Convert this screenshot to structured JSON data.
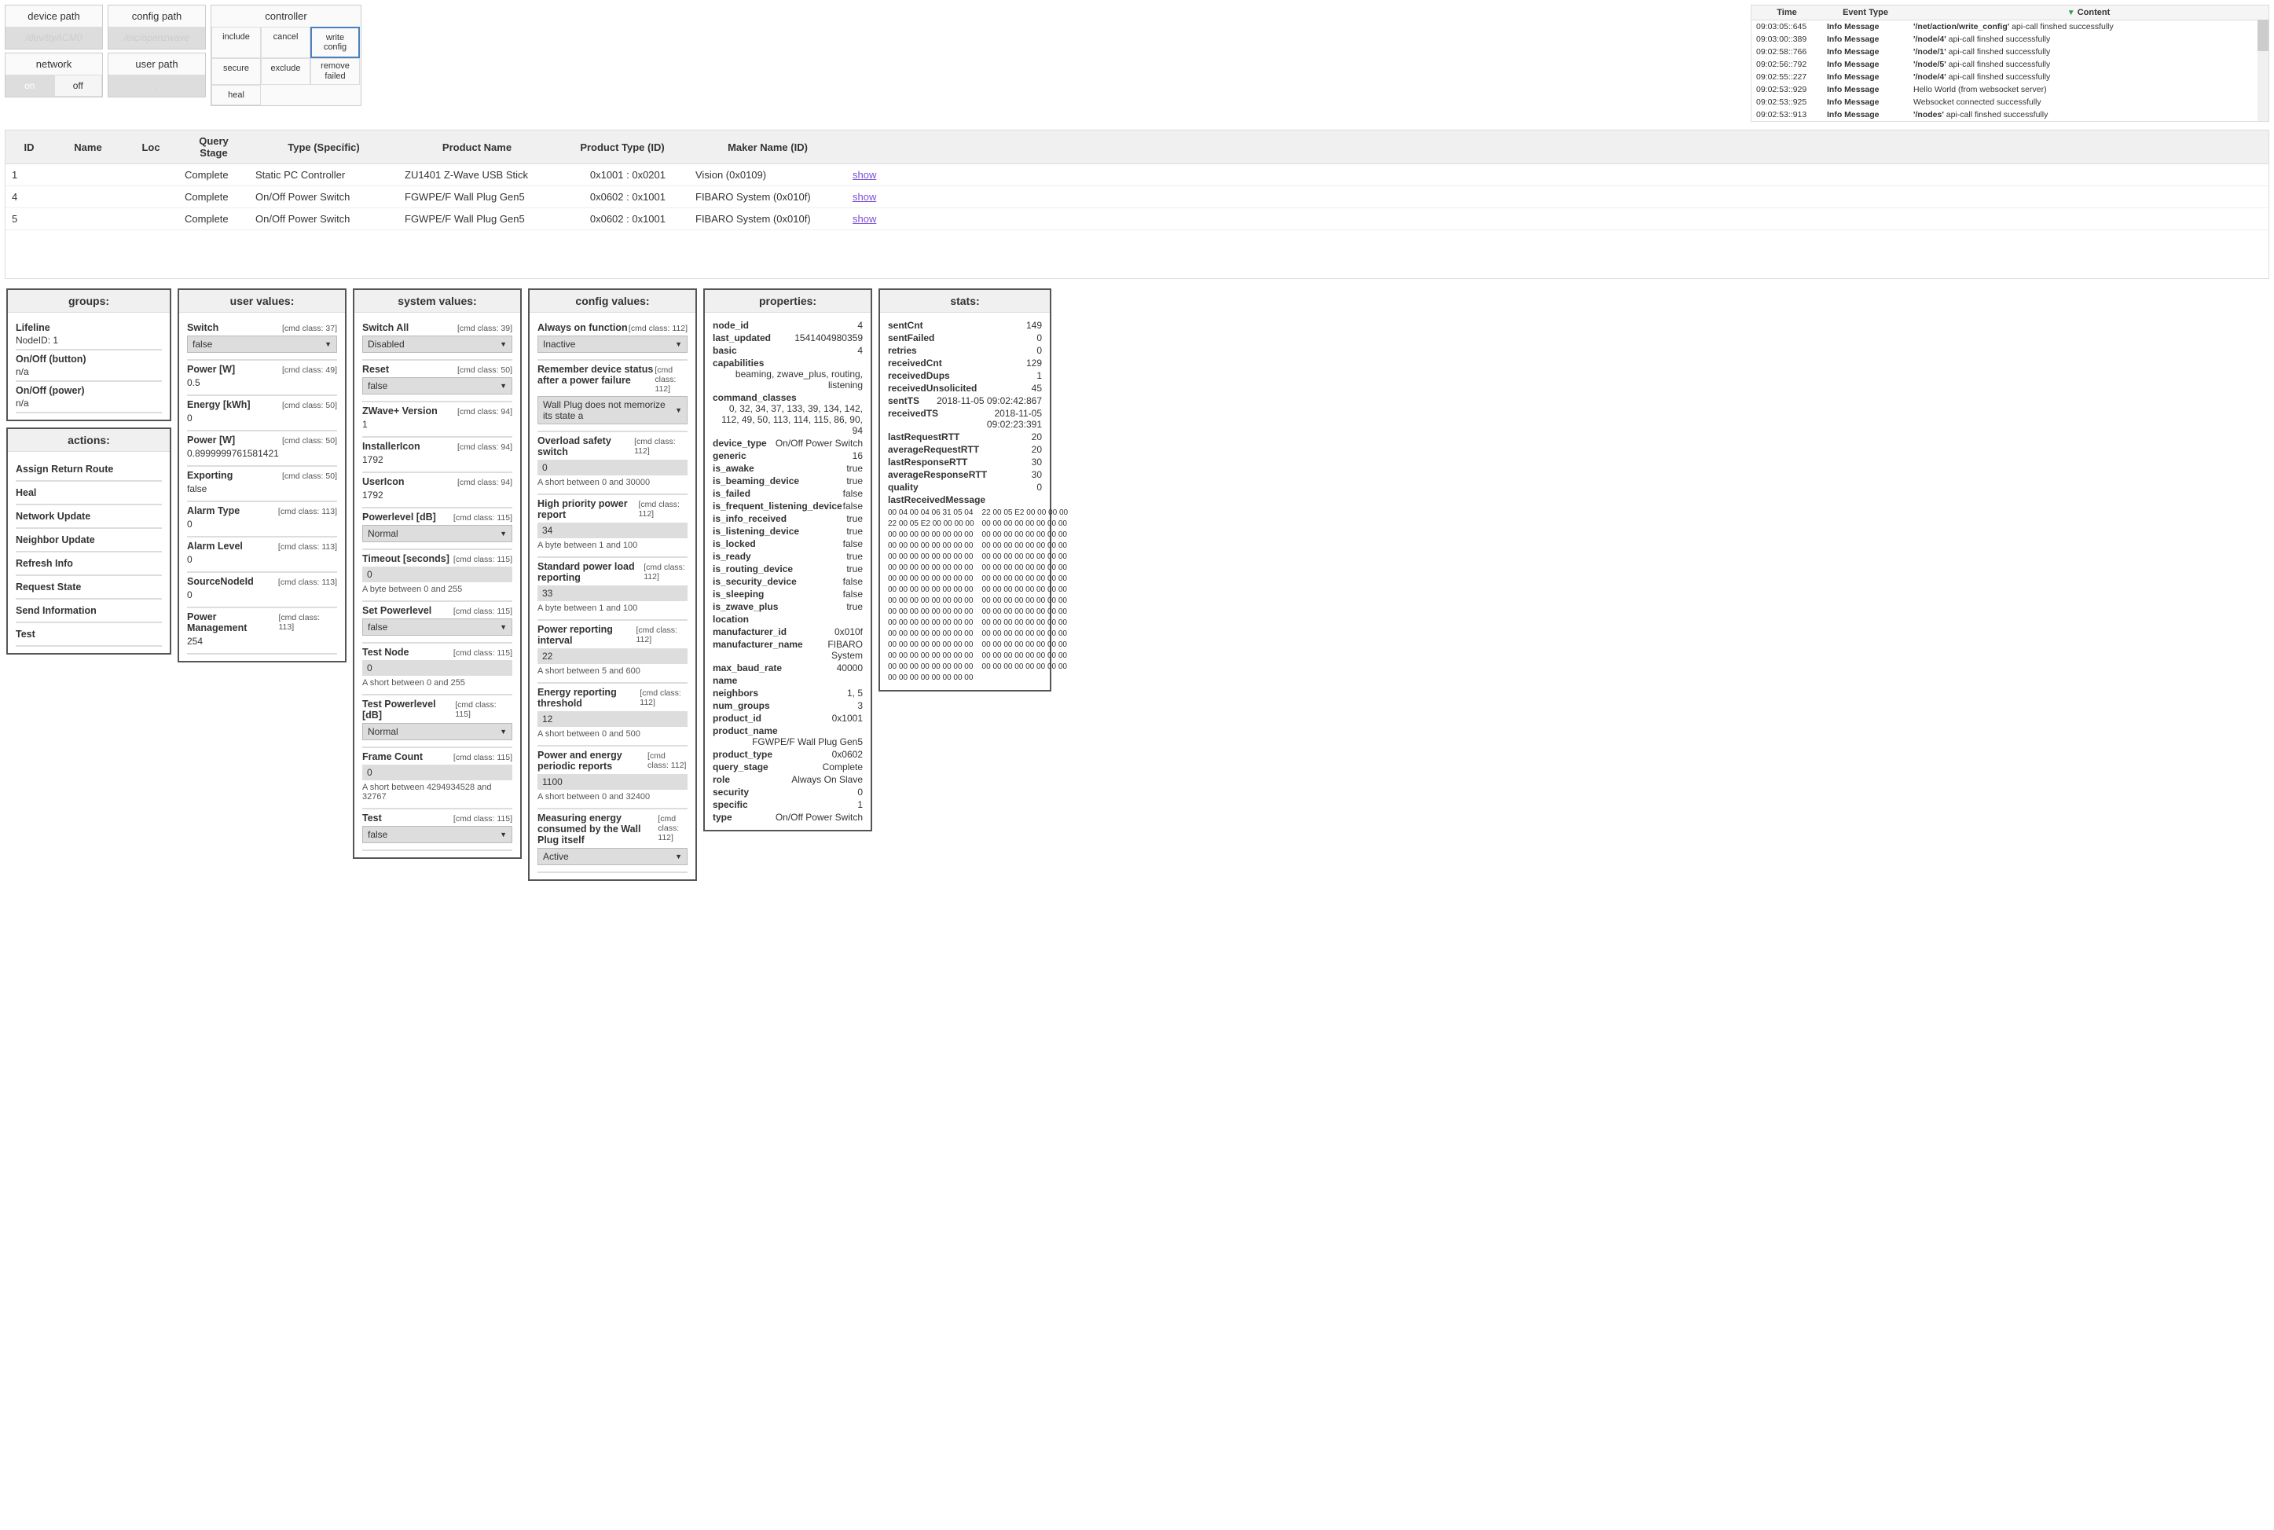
{
  "panels": {
    "device_path": {
      "label": "device path",
      "value": "/dev/ttyACM0"
    },
    "config_path": {
      "label": "config path",
      "value": "/etc/openzwave"
    },
    "network": {
      "label": "network",
      "on": "on",
      "off": "off"
    },
    "user_path": {
      "label": "user path",
      "value": "."
    },
    "controller": {
      "label": "controller",
      "include": "include",
      "cancel": "cancel",
      "write_config": "write config",
      "secure": "secure",
      "exclude": "exclude",
      "remove_failed": "remove\nfailed",
      "heal": "heal"
    }
  },
  "log": {
    "headers": {
      "time": "Time",
      "event_type": "Event Type",
      "content": "Content"
    },
    "rows": [
      {
        "time": "09:03:05::645",
        "type": "Info Message",
        "bold": "'/net/action/write_config'",
        "rest": " api-call finshed successfully"
      },
      {
        "time": "09:03:00::389",
        "type": "Info Message",
        "bold": "'/node/4'",
        "rest": " api-call finshed successfully"
      },
      {
        "time": "09:02:58::766",
        "type": "Info Message",
        "bold": "'/node/1'",
        "rest": " api-call finshed successfully"
      },
      {
        "time": "09:02:56::792",
        "type": "Info Message",
        "bold": "'/node/5'",
        "rest": " api-call finshed successfully"
      },
      {
        "time": "09:02:55::227",
        "type": "Info Message",
        "bold": "'/node/4'",
        "rest": " api-call finshed successfully"
      },
      {
        "time": "09:02:53::929",
        "type": "Info Message",
        "bold": "",
        "rest": "Hello World (from websocket server)"
      },
      {
        "time": "09:02:53::925",
        "type": "Info Message",
        "bold": "",
        "rest": "Websocket connected successfully"
      },
      {
        "time": "09:02:53::913",
        "type": "Info Message",
        "bold": "'/nodes'",
        "rest": " api-call finshed successfully"
      }
    ]
  },
  "node_table": {
    "headers": {
      "id": "ID",
      "name": "Name",
      "loc": "Loc",
      "query": "Query Stage",
      "type": "Type (Specific)",
      "product": "Product Name",
      "ptype": "Product Type (ID)",
      "maker": "Maker Name (ID)"
    },
    "rows": [
      {
        "id": "1",
        "name": "",
        "loc": "",
        "query": "Complete",
        "type": "Static PC Controller",
        "product": "ZU1401 Z-Wave USB Stick",
        "ptype": "0x1001 : 0x0201",
        "maker": "Vision (0x0109)",
        "show": "show"
      },
      {
        "id": "4",
        "name": "",
        "loc": "",
        "query": "Complete",
        "type": "On/Off Power Switch",
        "product": "FGWPE/F Wall Plug Gen5",
        "ptype": "0x0602 : 0x1001",
        "maker": "FIBARO System (0x010f)",
        "show": "show"
      },
      {
        "id": "5",
        "name": "",
        "loc": "",
        "query": "Complete",
        "type": "On/Off Power Switch",
        "product": "FGWPE/F Wall Plug Gen5",
        "ptype": "0x0602 : 0x1001",
        "maker": "FIBARO System (0x010f)",
        "show": "show"
      }
    ]
  },
  "groups": {
    "title": "groups:",
    "items": [
      {
        "name": "Lifeline",
        "sub": "NodeID: 1"
      },
      {
        "name": "On/Off (button)",
        "sub": "n/a"
      },
      {
        "name": "On/Off (power)",
        "sub": "n/a"
      }
    ]
  },
  "actions": {
    "title": "actions:",
    "items": [
      "Assign Return Route",
      "Heal",
      "Network Update",
      "Neighbor Update",
      "Refresh Info",
      "Request State",
      "Send Information",
      "Test"
    ]
  },
  "user_values": {
    "title": "user values:",
    "items": [
      {
        "name": "Switch",
        "cls": "[cmd class: 37]",
        "kind": "select",
        "value": "false"
      },
      {
        "name": "Power [W]",
        "cls": "[cmd class: 49]",
        "kind": "text",
        "value": "0.5"
      },
      {
        "name": "Energy [kWh]",
        "cls": "[cmd class: 50]",
        "kind": "text",
        "value": "0"
      },
      {
        "name": "Power [W]",
        "cls": "[cmd class: 50]",
        "kind": "text",
        "value": "0.8999999761581421"
      },
      {
        "name": "Exporting",
        "cls": "[cmd class: 50]",
        "kind": "text",
        "value": "false"
      },
      {
        "name": "Alarm Type",
        "cls": "[cmd class: 113]",
        "kind": "text",
        "value": "0"
      },
      {
        "name": "Alarm Level",
        "cls": "[cmd class: 113]",
        "kind": "text",
        "value": "0"
      },
      {
        "name": "SourceNodeId",
        "cls": "[cmd class: 113]",
        "kind": "text",
        "value": "0"
      },
      {
        "name": "Power Management",
        "cls": "[cmd class: 113]",
        "kind": "text",
        "value": "254"
      }
    ]
  },
  "system_values": {
    "title": "system values:",
    "items": [
      {
        "name": "Switch All",
        "cls": "[cmd class: 39]",
        "kind": "select",
        "value": "Disabled"
      },
      {
        "name": "Reset",
        "cls": "[cmd class: 50]",
        "kind": "select",
        "value": "false"
      },
      {
        "name": "ZWave+ Version",
        "cls": "[cmd class: 94]",
        "kind": "text",
        "value": "1"
      },
      {
        "name": "InstallerIcon",
        "cls": "[cmd class: 94]",
        "kind": "text",
        "value": "1792"
      },
      {
        "name": "UserIcon",
        "cls": "[cmd class: 94]",
        "kind": "text",
        "value": "1792"
      },
      {
        "name": "Powerlevel [dB]",
        "cls": "[cmd class: 115]",
        "kind": "select",
        "value": "Normal"
      },
      {
        "name": "Timeout [seconds]",
        "cls": "[cmd class: 115]",
        "kind": "input",
        "value": "0",
        "hint": "A byte between 0 and 255"
      },
      {
        "name": "Set Powerlevel",
        "cls": "[cmd class: 115]",
        "kind": "select",
        "value": "false"
      },
      {
        "name": "Test Node",
        "cls": "[cmd class: 115]",
        "kind": "input",
        "value": "0",
        "hint": "A short between 0 and 255"
      },
      {
        "name": "Test Powerlevel [dB]",
        "cls": "[cmd class: 115]",
        "kind": "select",
        "value": "Normal"
      },
      {
        "name": "Frame Count",
        "cls": "[cmd class: 115]",
        "kind": "input",
        "value": "0",
        "hint": "A short between 4294934528 and 32767"
      },
      {
        "name": "Test",
        "cls": "[cmd class: 115]",
        "kind": "select",
        "value": "false"
      }
    ]
  },
  "config_values": {
    "title": "config values:",
    "items": [
      {
        "name": "Always on function",
        "cls": "[cmd class: 112]",
        "kind": "select",
        "value": "Inactive"
      },
      {
        "name": "Remember device status after a power failure",
        "cls": "[cmd class: 112]",
        "kind": "select",
        "value": "Wall Plug does not memorize its state a"
      },
      {
        "name": "Overload safety switch",
        "cls": "[cmd class: 112]",
        "kind": "input",
        "value": "0",
        "hint": "A short between 0 and 30000"
      },
      {
        "name": "High priority power report",
        "cls": "[cmd class: 112]",
        "kind": "input",
        "value": "34",
        "hint": "A byte between 1 and 100"
      },
      {
        "name": "Standard power load reporting",
        "cls": "[cmd class: 112]",
        "kind": "input",
        "value": "33",
        "hint": "A byte between 1 and 100"
      },
      {
        "name": "Power reporting interval",
        "cls": "[cmd class: 112]",
        "kind": "input",
        "value": "22",
        "hint": "A short between 5 and 600"
      },
      {
        "name": "Energy reporting threshold",
        "cls": "[cmd class: 112]",
        "kind": "input",
        "value": "12",
        "hint": "A short between 0 and 500"
      },
      {
        "name": "Power and energy periodic reports",
        "cls": "[cmd class: 112]",
        "kind": "input",
        "value": "1100",
        "hint": "A short between 0 and 32400"
      },
      {
        "name": "Measuring energy consumed by the Wall Plug itself",
        "cls": "[cmd class: 112]",
        "kind": "select",
        "value": "Active"
      }
    ]
  },
  "properties": {
    "title": "properties:",
    "rows": [
      {
        "k": "node_id",
        "v": "4"
      },
      {
        "k": "last_updated",
        "v": "1541404980359"
      },
      {
        "k": "basic",
        "v": "4"
      },
      {
        "k": "capabilities",
        "v": "beaming, zwave_plus, routing, listening",
        "wrap": true
      },
      {
        "k": "command_classes",
        "v": "0, 32, 34, 37, 133, 39, 134, 142, 112, 49, 50, 113, 114, 115, 86, 90, 94",
        "wrap": true
      },
      {
        "k": "device_type",
        "v": "On/Off Power Switch"
      },
      {
        "k": "generic",
        "v": "16"
      },
      {
        "k": "is_awake",
        "v": "true"
      },
      {
        "k": "is_beaming_device",
        "v": "true"
      },
      {
        "k": "is_failed",
        "v": "false"
      },
      {
        "k": "is_frequent_listening_device",
        "v": "false"
      },
      {
        "k": "is_info_received",
        "v": "true"
      },
      {
        "k": "is_listening_device",
        "v": "true"
      },
      {
        "k": "is_locked",
        "v": "false"
      },
      {
        "k": "is_ready",
        "v": "true"
      },
      {
        "k": "is_routing_device",
        "v": "true"
      },
      {
        "k": "is_security_device",
        "v": "false"
      },
      {
        "k": "is_sleeping",
        "v": "false"
      },
      {
        "k": "is_zwave_plus",
        "v": "true"
      },
      {
        "k": "location",
        "v": ""
      },
      {
        "k": "manufacturer_id",
        "v": "0x010f"
      },
      {
        "k": "manufacturer_name",
        "v": "FIBARO System"
      },
      {
        "k": "max_baud_rate",
        "v": "40000"
      },
      {
        "k": "name",
        "v": ""
      },
      {
        "k": "neighbors",
        "v": "1, 5"
      },
      {
        "k": "num_groups",
        "v": "3"
      },
      {
        "k": "product_id",
        "v": "0x1001"
      },
      {
        "k": "product_name",
        "v": "FGWPE/F Wall Plug Gen5",
        "wrap": true
      },
      {
        "k": "product_type",
        "v": "0x0602"
      },
      {
        "k": "query_stage",
        "v": "Complete"
      },
      {
        "k": "role",
        "v": "Always On Slave"
      },
      {
        "k": "security",
        "v": "0"
      },
      {
        "k": "specific",
        "v": "1"
      },
      {
        "k": "type",
        "v": "On/Off Power Switch"
      }
    ]
  },
  "stats": {
    "title": "stats:",
    "rows": [
      {
        "k": "sentCnt",
        "v": "149"
      },
      {
        "k": "sentFailed",
        "v": "0"
      },
      {
        "k": "retries",
        "v": "0"
      },
      {
        "k": "receivedCnt",
        "v": "129"
      },
      {
        "k": "receivedDups",
        "v": "1"
      },
      {
        "k": "receivedUnsolicited",
        "v": "45"
      },
      {
        "k": "sentTS",
        "v": "2018-11-05 09:02:42:867"
      },
      {
        "k": "receivedTS",
        "v": "2018-11-05 09:02:23:391"
      },
      {
        "k": "lastRequestRTT",
        "v": "20"
      },
      {
        "k": "averageRequestRTT",
        "v": "20"
      },
      {
        "k": "lastResponseRTT",
        "v": "30"
      },
      {
        "k": "averageResponseRTT",
        "v": "30"
      },
      {
        "k": "quality",
        "v": "0"
      },
      {
        "k": "lastReceivedMessage",
        "v": ""
      }
    ],
    "hex_col1": "00 04 00 04 06 31 05 04\n22 00 05 E2 00 00 00 00\n00 00 00 00 00 00 00 00\n00 00 00 00 00 00 00 00\n00 00 00 00 00 00 00 00\n00 00 00 00 00 00 00 00\n00 00 00 00 00 00 00 00\n00 00 00 00 00 00 00 00\n00 00 00 00 00 00 00 00\n00 00 00 00 00 00 00 00\n00 00 00 00 00 00 00 00\n00 00 00 00 00 00 00 00\n00 00 00 00 00 00 00 00\n00 00 00 00 00 00 00 00\n00 00 00 00 00 00 00 00\n00 00 00 00 00 00 00 00",
    "hex_col2": "22 00 05 E2 00 00 00 00\n00 00 00 00 00 00 00 00\n00 00 00 00 00 00 00 00\n00 00 00 00 00 00 00 00\n00 00 00 00 00 00 00 00\n00 00 00 00 00 00 00 00\n00 00 00 00 00 00 00 00\n00 00 00 00 00 00 00 00\n00 00 00 00 00 00 00 00\n00 00 00 00 00 00 00 00\n00 00 00 00 00 00 00 00\n00 00 00 00 00 00 00 00\n00 00 00 00 00 00 00 00\n00 00 00 00 00 00 00 00\n00 00 00 00 00 00 00 00"
  }
}
